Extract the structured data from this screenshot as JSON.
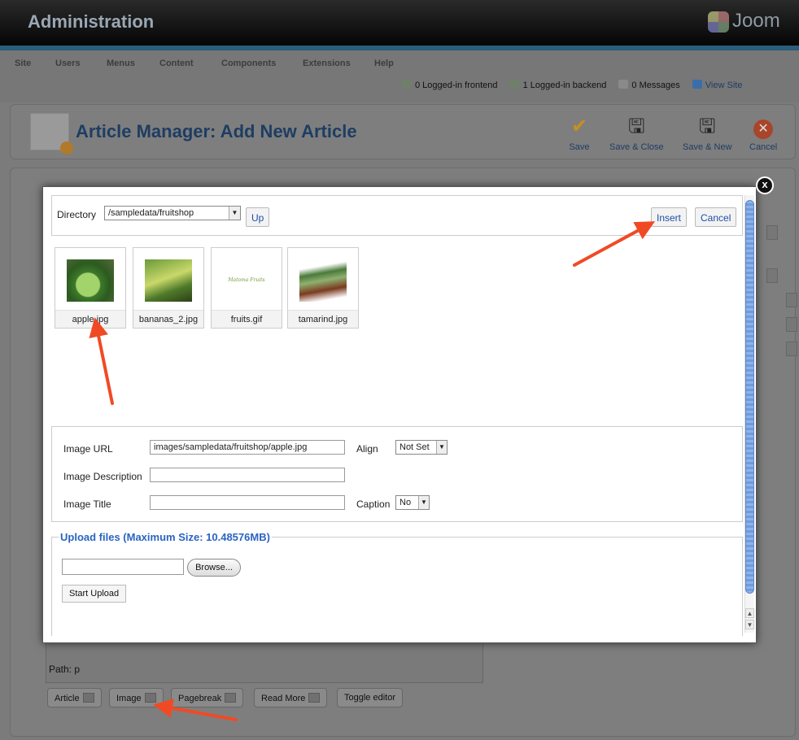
{
  "header": {
    "title": "Administration",
    "logo_text": "Joom"
  },
  "menu": [
    "Site",
    "Users",
    "Menus",
    "Content",
    "Components",
    "Extensions",
    "Help"
  ],
  "status": {
    "frontend": "0 Logged-in frontend",
    "backend": "1 Logged-in backend",
    "messages": "0 Messages",
    "view_site": "View Site"
  },
  "page": {
    "title": "Article Manager: Add New Article"
  },
  "toolbar": {
    "save": "Save",
    "save_close": "Save & Close",
    "save_new": "Save & New",
    "cancel": "Cancel"
  },
  "modal": {
    "directory_label": "Directory",
    "directory_value": "/sampledata/fruitshop",
    "up_label": "Up",
    "insert_label": "Insert",
    "cancel_label": "Cancel",
    "images": [
      {
        "name": "apple.jpg"
      },
      {
        "name": "bananas_2.jpg"
      },
      {
        "name": "fruits.gif",
        "preview_text": "Matoma Fruits"
      },
      {
        "name": "tamarind.jpg"
      }
    ],
    "image_url_label": "Image URL",
    "image_url_value": "images/sampledata/fruitshop/apple.jpg",
    "align_label": "Align",
    "align_value": "Not Set",
    "description_label": "Image Description",
    "title_label": "Image Title",
    "caption_label": "Caption",
    "caption_value": "No",
    "upload_legend": "Upload files (Maximum Size: 10.48576MB)",
    "browse_label": "Browse...",
    "start_upload_label": "Start Upload",
    "close_glyph": "x"
  },
  "editor": {
    "path": "Path: p",
    "buttons": [
      "Article",
      "Image",
      "Pagebreak",
      "Read More",
      "Toggle editor"
    ]
  },
  "colors": {
    "arrow": "#f04a25",
    "link_blue": "#2a64c0",
    "header_stripe": "#2a5d7a"
  }
}
